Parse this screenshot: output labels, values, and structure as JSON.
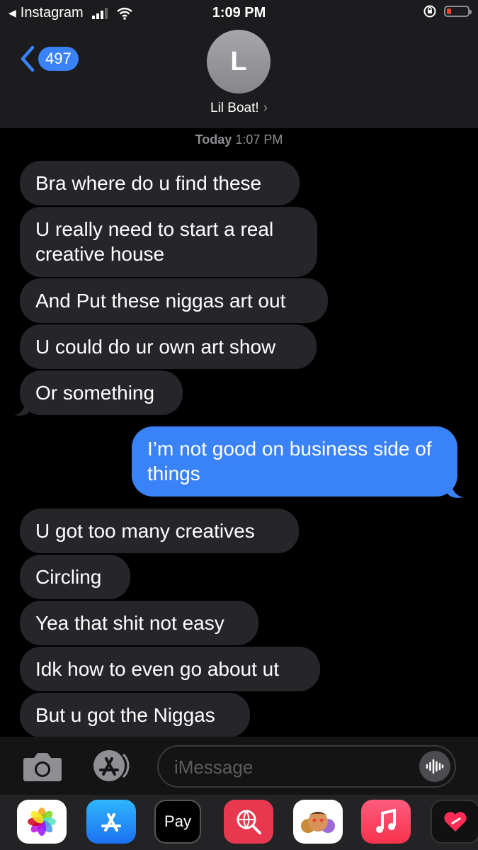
{
  "status_bar": {
    "back_app": "Instagram",
    "time": "1:09 PM",
    "battery_level": 0.2
  },
  "header": {
    "back_count": "497",
    "avatar_initial": "L",
    "contact_name": "Lil Boat!",
    "chevron": "›"
  },
  "timestamp": {
    "day": "Today",
    "time": "1:07 PM"
  },
  "messages": [
    {
      "from": "them",
      "text": "Bra where do u find these"
    },
    {
      "from": "them",
      "text": "U really need to start a real creative house"
    },
    {
      "from": "them",
      "text": "And Put these niggas art out"
    },
    {
      "from": "them",
      "text": "U could do ur own art show"
    },
    {
      "from": "them",
      "text": "Or something"
    },
    {
      "from": "me",
      "text": "I’m not good on business side of things"
    },
    {
      "from": "them",
      "text": "U got too many creatives"
    },
    {
      "from": "them",
      "text": "Circling"
    },
    {
      "from": "them",
      "text": "Yea that shit not easy"
    },
    {
      "from": "them",
      "text": "Idk how to even go about ut"
    },
    {
      "from": "them",
      "text": "But u got the Niggas"
    }
  ],
  "input": {
    "placeholder": "iMessage"
  },
  "apps": [
    {
      "name": "photos-icon"
    },
    {
      "name": "app-store-icon"
    },
    {
      "name": "apple-pay-icon",
      "label": "Pay"
    },
    {
      "name": "web-search-icon"
    },
    {
      "name": "memoji-icon"
    },
    {
      "name": "music-icon"
    },
    {
      "name": "heart-app-icon"
    }
  ],
  "colors": {
    "accent": "#3a82f7",
    "incoming_bubble": "#26252a",
    "header_bg": "#1c1c1e"
  }
}
